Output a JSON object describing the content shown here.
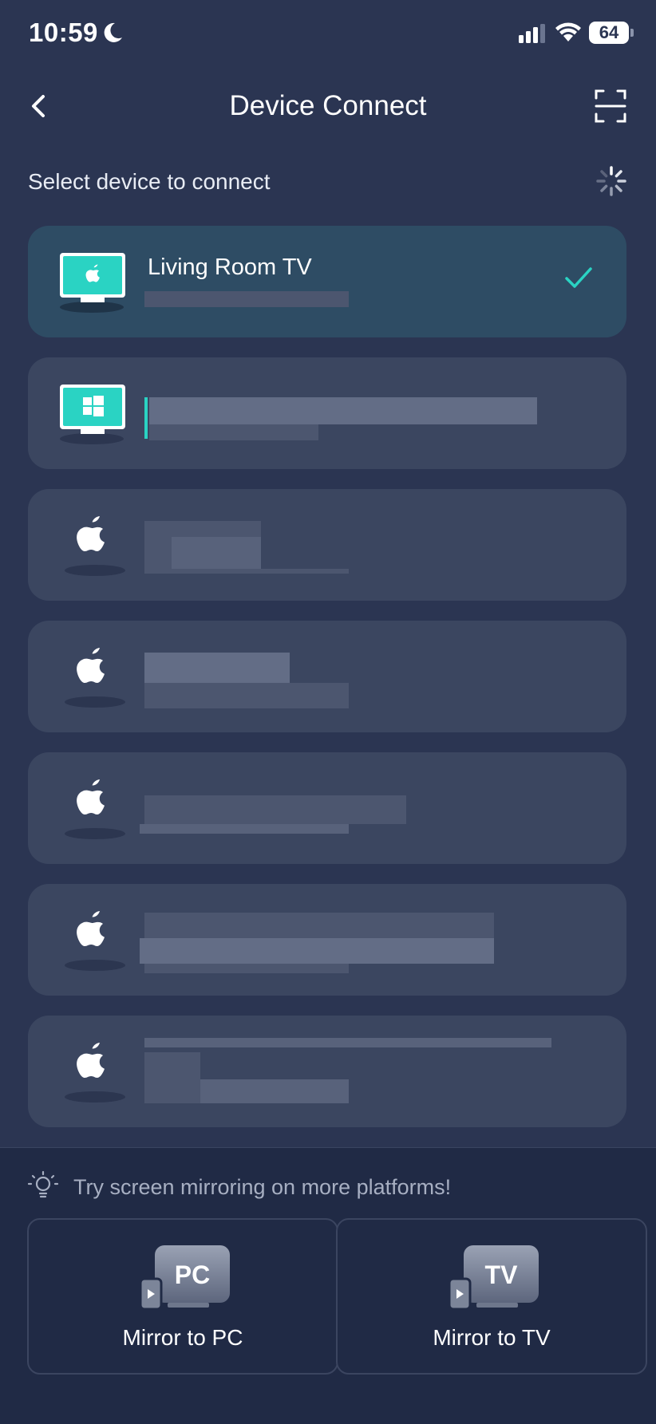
{
  "status_bar": {
    "time": "10:59",
    "battery": "64"
  },
  "nav": {
    "title": "Device Connect"
  },
  "section": {
    "label": "Select device to connect"
  },
  "devices": [
    {
      "name": "Living Room TV",
      "type": "apple-tv",
      "selected": true
    },
    {
      "name": "",
      "type": "windows-pc",
      "selected": false
    },
    {
      "name": "",
      "type": "apple",
      "selected": false
    },
    {
      "name": "",
      "type": "apple",
      "selected": false
    },
    {
      "name": "",
      "type": "apple",
      "selected": false
    },
    {
      "name": "",
      "type": "apple",
      "selected": false
    },
    {
      "name": "",
      "type": "apple",
      "selected": false
    }
  ],
  "bottom": {
    "tip": "Try screen mirroring on more platforms!",
    "pc": {
      "icon_text": "PC",
      "label": "Mirror to PC"
    },
    "tv": {
      "icon_text": "TV",
      "label": "Mirror to TV"
    }
  },
  "colors": {
    "background": "#2b3552",
    "card": "#3b4660",
    "selected_card": "#2e4c64",
    "accent": "#2ad3c3"
  }
}
